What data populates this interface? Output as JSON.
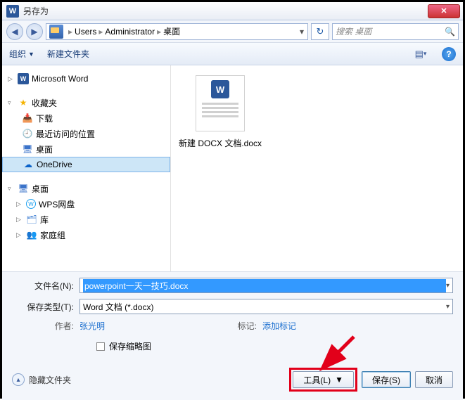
{
  "window": {
    "title": "另存为"
  },
  "breadcrumb": {
    "items": [
      "Users",
      "Administrator",
      "桌面"
    ],
    "sep": "▸"
  },
  "search": {
    "placeholder": "搜索 桌面"
  },
  "toolbar": {
    "organize": "组织",
    "newfolder": "新建文件夹"
  },
  "tree": {
    "word": "Microsoft Word",
    "fav": "收藏夹",
    "download": "下载",
    "recent": "最近访问的位置",
    "desktop1": "桌面",
    "onedrive": "OneDrive",
    "desktop2": "桌面",
    "wps": "WPS网盘",
    "library": "库",
    "homegroup": "家庭组"
  },
  "file": {
    "name": "新建 DOCX 文档.docx"
  },
  "form": {
    "name_label": "文件名(N):",
    "name_value": "powerpoint一天一技巧.docx",
    "type_label": "保存类型(T):",
    "type_value": "Word 文档 (*.docx)"
  },
  "meta": {
    "author_label": "作者:",
    "author_value": "张光明",
    "tag_label": "标记:",
    "tag_value": "添加标记",
    "thumb_label": "保存缩略图"
  },
  "footer": {
    "hidefiles": "隐藏文件夹",
    "tools": "工具(L)",
    "save": "保存(S)",
    "cancel": "取消"
  }
}
